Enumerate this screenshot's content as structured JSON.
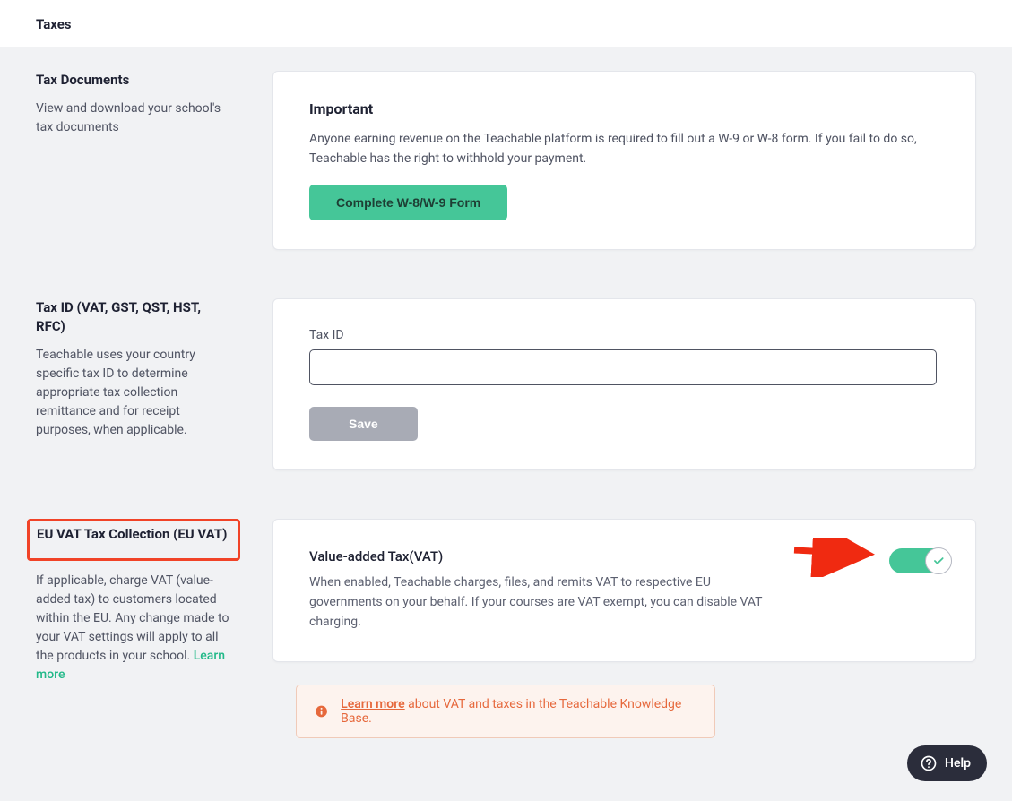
{
  "page_title": "Taxes",
  "sections": {
    "docs": {
      "title": "Tax Documents",
      "desc": "View and download your school's tax documents"
    },
    "taxid": {
      "title": "Tax ID (VAT, GST, QST, HST, RFC)",
      "desc": "Teachable uses your country specific tax ID to determine appropriate tax collection remittance and for receipt purposes, when applicable."
    },
    "euvat": {
      "title": "EU VAT Tax Collection (EU VAT)",
      "desc": "If applicable, charge VAT (value-added tax) to customers located within the EU. Any change made to your VAT settings will apply to all the products in your school. ",
      "learn": "Learn more"
    }
  },
  "cards": {
    "important": {
      "heading": "Important",
      "body": "Anyone earning revenue on the Teachable platform is required to fill out a W-9 or W-8 form. If you fail to do so, Teachable has the right to withhold your payment.",
      "button": "Complete W-8/W-9 Form"
    },
    "taxid": {
      "label": "Tax ID",
      "value": "",
      "save": "Save"
    },
    "vat": {
      "heading": "Value-added Tax(VAT)",
      "body": "When enabled, Teachable charges, files, and remits VAT to respective EU governments on your behalf. If your courses are VAT exempt, you can disable VAT charging.",
      "enabled": true
    }
  },
  "info_bar": {
    "link": "Learn more",
    "rest": " about VAT and taxes in the Teachable Knowledge Base."
  },
  "help": "Help"
}
